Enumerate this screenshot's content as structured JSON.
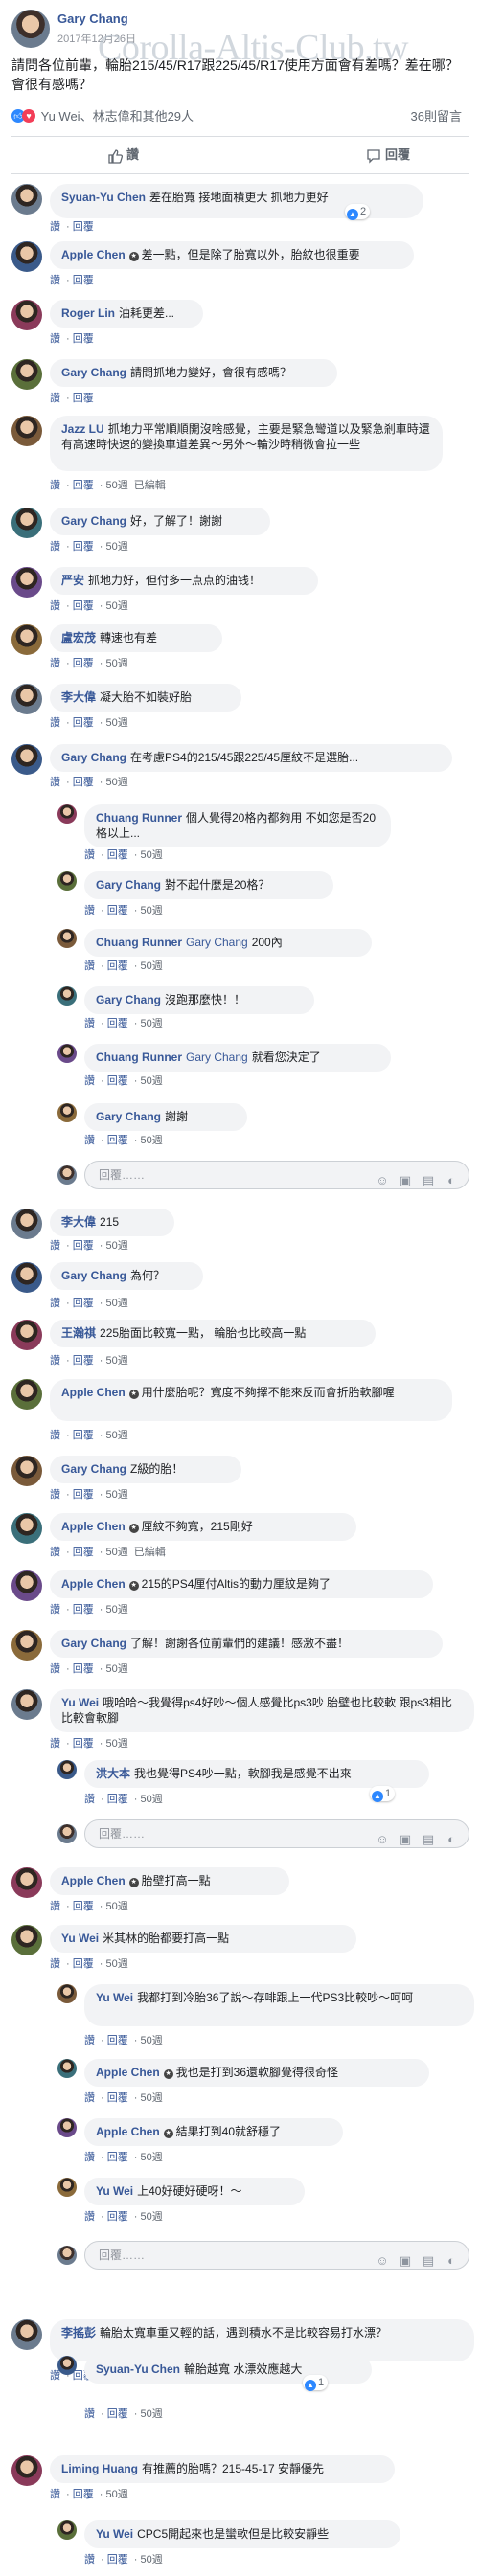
{
  "post": {
    "author": "Gary Chang",
    "date": "2017年12月26日",
    "watermark": "Corolla-Altis-Club.tw",
    "text": "請問各位前輩，輪胎215/45/R17跟225/45/R17使用方面會有差嗎？差在哪？會很有感嗎？",
    "reactions_text": "Yu Wei、林志偉和其他29人",
    "shares": "36則留言"
  },
  "actions": {
    "like": "讚",
    "comment": "回覆"
  },
  "labels": {
    "like": "讚",
    "reply": "回覆",
    "edited": "已編輯",
    "placeholder": "回覆……"
  },
  "comments": [
    {
      "author": "Syuan-Yu Chen",
      "text": "差在胎寬 接地面積更大 抓地力更好",
      "likes": "2"
    },
    {
      "author": "Apple Chen",
      "badge": true,
      "text": "差一點，但是除了胎寬以外，胎紋也很重要"
    },
    {
      "author": "Roger Lin",
      "text": "油耗更差..."
    },
    {
      "author": "Gary Chang",
      "text": "請問抓地力變好，會很有感嗎？"
    },
    {
      "author": "Jazz LU",
      "text": "抓地力平常順順開沒啥感覺，主要是緊急彎道以及緊急剎車時還有高速時快速的變換車道差異～另外～輪沙時稍微會拉一些",
      "time": "50週",
      "edited": true
    },
    {
      "author": "Gary Chang",
      "text": "好，了解了！謝謝",
      "time": "50週"
    },
    {
      "author": "严安",
      "text": "抓地力好，但付多一点点的油钱！",
      "time": "50週"
    },
    {
      "author": "盧宏茂",
      "text": "轉速也有差",
      "time": "50週"
    },
    {
      "author": "李大偉",
      "text": "凝大胎不如裝好胎",
      "time": "50週"
    },
    {
      "author": "Gary Chang",
      "text": "在考慮PS4的215/45跟225/45厘紋不是選胎...",
      "time": "50週"
    },
    {
      "author": "Chuang Runner",
      "text": "個人覺得20格內都夠用 不如您是否20格以上...",
      "time": "50週"
    },
    {
      "author": "Gary Chang",
      "text": "對不起什麼是20格？",
      "time": "50週"
    },
    {
      "author": "Chuang Runner",
      "tag": "Gary Chang",
      "text": "200內",
      "time": "50週"
    },
    {
      "author": "Gary Chang",
      "text": "沒跑那麼快！！",
      "time": "50週"
    },
    {
      "author": "Chuang Runner",
      "tag": "Gary Chang",
      "text": "就看您決定了",
      "time": "50週"
    },
    {
      "author": "Gary Chang",
      "text": "謝謝",
      "time": "50週"
    },
    {
      "author": "李大偉",
      "text": "215",
      "time": "50週"
    },
    {
      "author": "Gary Chang",
      "text": "為何？",
      "time": "50週"
    },
    {
      "author": "王瀚祺",
      "text": "225胎面比較寬一點， 輪胎也比較高一點",
      "time": "50週"
    },
    {
      "author": "Apple Chen",
      "badge": true,
      "text": "用什麼胎呢？寬度不夠擇不能來反而會折胎軟腳喔",
      "time": "50週"
    },
    {
      "author": "Gary Chang",
      "text": "Z級的胎！",
      "time": "50週"
    },
    {
      "author": "Apple Chen",
      "badge": true,
      "text": "厘紋不夠寬，215剛好",
      "time": "50週",
      "edited": true
    },
    {
      "author": "Apple Chen",
      "badge": true,
      "text": "215的PS4厘付Altis的動力厘紋是夠了",
      "time": "50週"
    },
    {
      "author": "Gary Chang",
      "text": "了解！謝謝各位前輩們的建議！感激不盡！",
      "time": "50週"
    },
    {
      "author": "Yu Wei",
      "text": "哦哈哈～我覺得ps4好吵～個人感覺比ps3吵 胎壁也比較軟 跟ps3相比比較會軟腳",
      "time": "50週"
    },
    {
      "author": "洪大本",
      "text": "我也覺得PS4吵一點，軟腳我是感覺不出來",
      "time": "50週",
      "likes": "1"
    },
    {
      "author": "Apple Chen",
      "badge": true,
      "text": "胎壁打高一點",
      "time": "50週"
    },
    {
      "author": "Yu Wei",
      "text": "米其林的胎都要打高一點",
      "time": "50週"
    },
    {
      "author": "Yu Wei",
      "text": "我都打到冷胎36了說～存啡跟上一代PS3比較吵～呵呵",
      "time": "50週"
    },
    {
      "author": "Apple Chen",
      "badge": true,
      "text": "我也是打到36還軟腳覺得很奇怪",
      "time": "50週"
    },
    {
      "author": "Apple Chen",
      "badge": true,
      "text": "結果打到40就舒穩了",
      "time": "50週"
    },
    {
      "author": "Yu Wei",
      "text": "上40好硬好硬呀！～",
      "time": "50週"
    },
    {
      "author": "李搖彭",
      "text": "輪胎太寬車重又輕的話，遇到積水不是比較容易打水漂？",
      "time": "50週"
    },
    {
      "author": "Syuan-Yu Chen",
      "text": "輪胎越寬 水漂效應越大",
      "time": "50週",
      "likes": "1"
    },
    {
      "author": "Liming Huang",
      "text": "有推薦的胎嗎？215-45-17 安靜優先",
      "time": "50週"
    },
    {
      "author": "Yu Wei",
      "text": "CPC5開起來也是蠻軟但是比較安靜些",
      "time": "50週"
    }
  ]
}
